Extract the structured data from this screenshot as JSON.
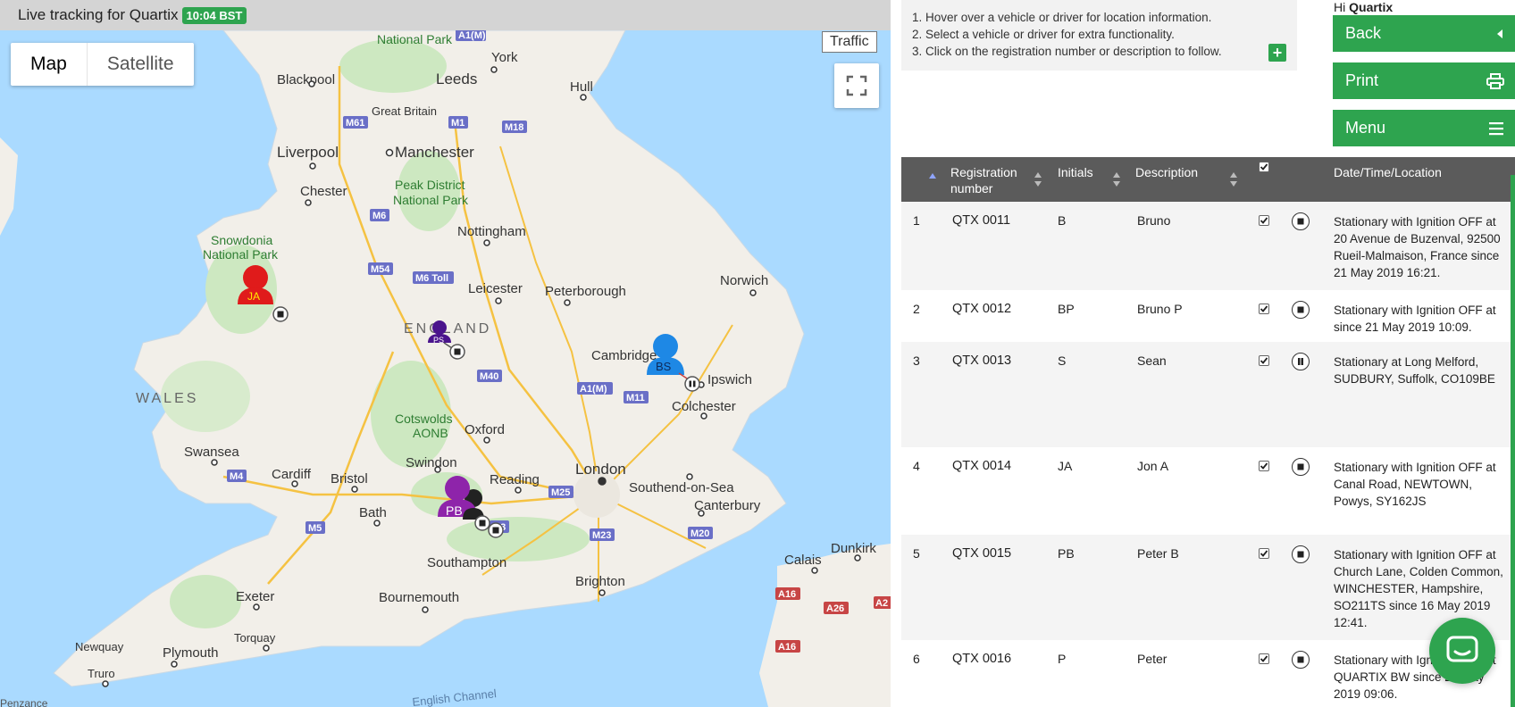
{
  "header": {
    "title": "Live tracking for Quartix",
    "time_badge": "10:04 BST"
  },
  "map": {
    "type_map": "Map",
    "type_satellite": "Satellite",
    "traffic": "Traffic",
    "places": {
      "national_park_top": "National Park",
      "york": "York",
      "leeds": "Leeds",
      "blackpool": "Blackpool",
      "hull": "Hull",
      "great_britain": "Great Britain",
      "liverpool": "Liverpool",
      "manchester": "Manchester",
      "chester": "Chester",
      "peak_district_1": "Peak District",
      "peak_district_2": "National Park",
      "snowdonia_1": "Snowdonia",
      "snowdonia_2": "National Park",
      "nottingham": "Nottingham",
      "leicester": "Leicester",
      "peterborough": "Peterborough",
      "norwich": "Norwich",
      "england": "ENGLAND",
      "cambridge": "Cambridge",
      "wales": "WALES",
      "ipswich": "Ipswich",
      "colchester": "Colchester",
      "cotswolds_1": "Cotswolds",
      "cotswolds_2": "AONB",
      "oxford": "Oxford",
      "swansea": "Swansea",
      "cardiff": "Cardiff",
      "bristol": "Bristol",
      "swindon": "Swindon",
      "reading": "Reading",
      "london": "London",
      "southend": "Southend-on-Sea",
      "canterbury": "Canterbury",
      "bath": "Bath",
      "southampton": "Southampton",
      "brighton": "Brighton",
      "dunkirk": "Dunkirk",
      "calais": "Calais",
      "exeter": "Exeter",
      "bournemouth": "Bournemouth",
      "newquay": "Newquay",
      "torquay": "Torquay",
      "plymouth": "Plymouth",
      "truro": "Truro",
      "english_channel": "English Channel",
      "penzance": "Penzance"
    },
    "roads": [
      "M6",
      "M61",
      "M1",
      "M18",
      "M6",
      "M54",
      "M6 Toll",
      "M40",
      "A1(M)",
      "M11",
      "M4",
      "M5",
      "M25",
      "M3",
      "M23",
      "M20",
      "A16",
      "A26",
      "A16",
      "A2",
      "A1(M)"
    ],
    "markers": [
      {
        "label": "JA",
        "color": "#e01b1b"
      },
      {
        "label": "PS",
        "color": "#4a148c"
      },
      {
        "label": "BS",
        "color": "#1e88e5"
      },
      {
        "label": "PB",
        "color": "#8e24aa"
      }
    ]
  },
  "side": {
    "instructions": [
      "1. Hover over a vehicle or driver for location information.",
      "2. Select a vehicle or driver for extra functionality.",
      "3. Click on the registration number or description to follow."
    ],
    "greeting_prefix": "Hi",
    "greeting_user": "Quartix",
    "buttons": {
      "back": "Back",
      "print": "Print",
      "menu": "Menu"
    }
  },
  "table": {
    "headers": {
      "reg_line1": "Registration",
      "reg_line2": "number",
      "initials": "Initials",
      "description": "Description",
      "datetime": "Date/Time/Location"
    },
    "rows": [
      {
        "n": "1",
        "reg": "QTX 0011",
        "init": "B",
        "desc": "Bruno",
        "state": "stop",
        "loc": [
          "Stationary with Ignition OFF at",
          "20 Avenue de Buzenval, 92500",
          "Rueil-Malmaison, France since",
          "21 May 2019 16:21."
        ]
      },
      {
        "n": "2",
        "reg": "QTX 0012",
        "init": "BP",
        "desc": "Bruno P",
        "state": "stop",
        "loc": [
          "Stationary with Ignition OFF at",
          "since 21 May 2019 10:09."
        ]
      },
      {
        "n": "3",
        "reg": "QTX 0013",
        "init": "S",
        "desc": "Sean",
        "state": "pause",
        "loc": [
          "Stationary at Long Melford,",
          "SUDBURY, Suffolk, CO109BE"
        ]
      },
      {
        "n": "4",
        "reg": "QTX 0014",
        "init": "JA",
        "desc": "Jon A",
        "state": "stop",
        "loc": [
          "Stationary with Ignition OFF at",
          "Canal Road, NEWTOWN,",
          "Powys, SY162JS"
        ]
      },
      {
        "n": "5",
        "reg": "QTX 0015",
        "init": "PB",
        "desc": "Peter B",
        "state": "stop",
        "loc": [
          "Stationary with Ignition OFF at",
          "Church Lane, Colden Common,",
          "WINCHESTER, Hampshire,",
          "SO211TS since 16 May 2019",
          "12:41."
        ]
      },
      {
        "n": "6",
        "reg": "QTX 0016",
        "init": "P",
        "desc": "Peter",
        "state": "stop",
        "loc": [
          "Stationary with Ignition OFF at",
          "QUARTIX BW since 22 May",
          "2019 09:06."
        ]
      }
    ]
  }
}
